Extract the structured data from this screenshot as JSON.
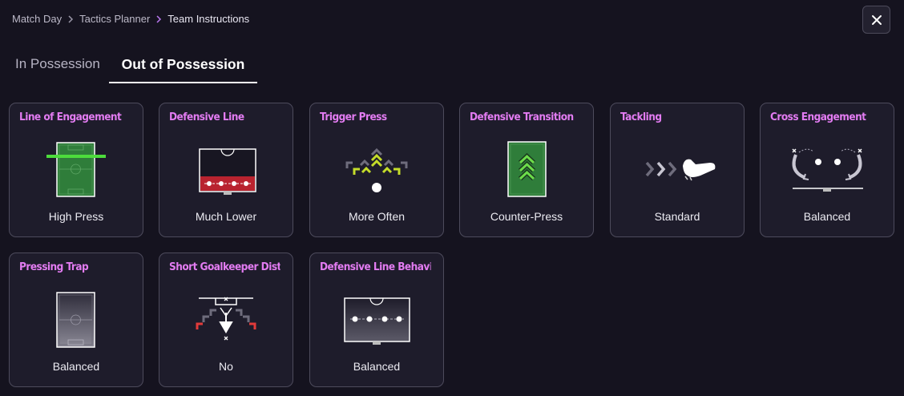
{
  "breadcrumb": [
    "Match Day",
    "Tactics Planner",
    "Team Instructions"
  ],
  "tabs": [
    {
      "label": "In Possession",
      "active": false
    },
    {
      "label": "Out of Possession",
      "active": true
    }
  ],
  "colors": {
    "accent": "#e37cf2",
    "pitch_green": "#2f7d3a",
    "highlight_green": "#4ddc3c",
    "defense_red": "#b9232f",
    "press_yellow": "#c4dc2a",
    "alert_red": "#e23a3a"
  },
  "cards": [
    {
      "title": "Line of Engagement",
      "value": "High Press",
      "icon": "high-press-pitch-icon"
    },
    {
      "title": "Defensive Line",
      "value": "Much Lower",
      "icon": "low-defensive-line-icon"
    },
    {
      "title": "Trigger Press",
      "value": "More Often",
      "icon": "trigger-press-arrows-icon"
    },
    {
      "title": "Defensive Transition",
      "value": "Counter-Press",
      "icon": "counter-press-pitch-icon"
    },
    {
      "title": "Tackling",
      "value": "Standard",
      "icon": "tackling-boot-icon"
    },
    {
      "title": "Cross Engagement",
      "value": "Balanced",
      "icon": "cross-engagement-icon"
    },
    {
      "title": "Pressing Trap",
      "value": "Balanced",
      "icon": "pressing-trap-pitch-icon"
    },
    {
      "title": "Short Goalkeeper Distribution",
      "value": "No",
      "icon": "goalkeeper-distribution-icon"
    },
    {
      "title": "Defensive Line Behaviour",
      "value": "Balanced",
      "icon": "defensive-line-behaviour-icon"
    }
  ]
}
